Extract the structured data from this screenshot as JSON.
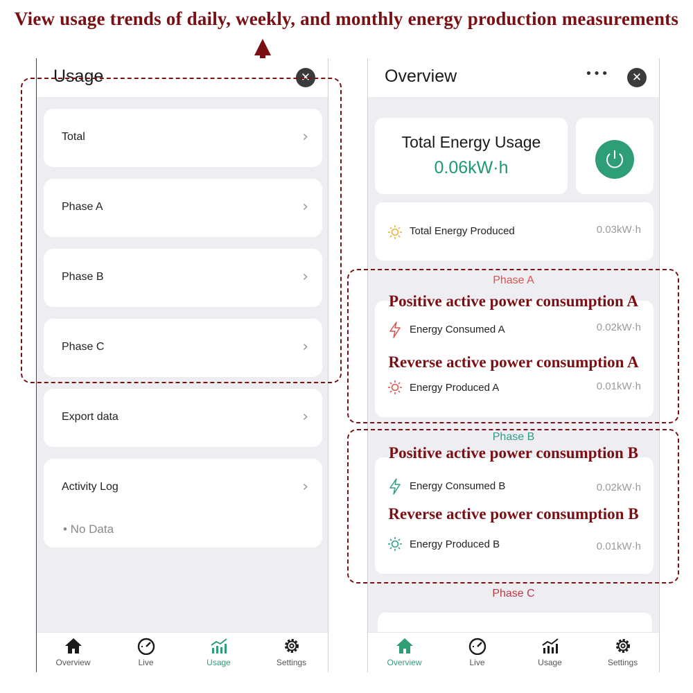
{
  "annotations": {
    "top_caption": "View usage trends of daily, weekly, and monthly energy production measurements",
    "phase_a_positive": "Positive active power consumption A",
    "phase_a_reverse": "Reverse active power consumption A",
    "phase_b_positive": "Positive active power consumption B",
    "phase_b_reverse": "Reverse active power consumption B"
  },
  "usage_screen": {
    "title": "Usage",
    "items": [
      {
        "label": "Total"
      },
      {
        "label": "Phase A"
      },
      {
        "label": "Phase B"
      },
      {
        "label": "Phase C"
      },
      {
        "label": "Export data"
      },
      {
        "label": "Activity Log"
      }
    ],
    "activity_empty": "• No Data"
  },
  "overview_screen": {
    "title": "Overview",
    "total_energy_usage": {
      "label": "Total Energy Usage",
      "value": "0.06kW·h"
    },
    "total_energy_produced": {
      "label": "Total Energy Produced",
      "value": "0.03kW·h"
    },
    "phase_a": {
      "title": "Phase A",
      "consumed": {
        "label": "Energy Consumed A",
        "value": "0.02kW·h"
      },
      "produced": {
        "label": "Energy Produced A",
        "value": "0.01kW·h"
      }
    },
    "phase_b": {
      "title": "Phase B",
      "consumed": {
        "label": "Energy Consumed B",
        "value": "0.02kW·h"
      },
      "produced": {
        "label": "Energy Produced B",
        "value": "0.01kW·h"
      }
    },
    "phase_c": {
      "title": "Phase C"
    }
  },
  "tabs": [
    {
      "label": "Overview",
      "icon": "home-icon"
    },
    {
      "label": "Live",
      "icon": "gauge-icon"
    },
    {
      "label": "Usage",
      "icon": "chart-icon"
    },
    {
      "label": "Settings",
      "icon": "gear-icon"
    }
  ],
  "colors": {
    "accent_green": "#2e9e77",
    "phase_a_red": "#d9534f",
    "phase_b_teal": "#2e9e8a",
    "phase_c_red": "#b83a46",
    "annotation": "#7a0f14",
    "sun_yellow": "#e8b43a"
  }
}
